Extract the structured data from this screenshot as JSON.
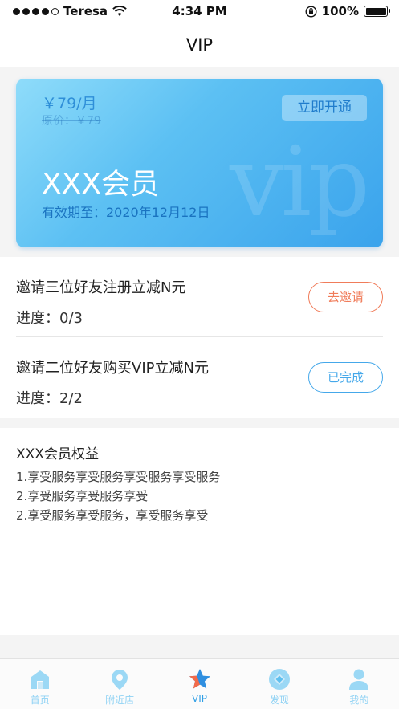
{
  "status_bar": {
    "carrier": "Teresa",
    "time": "4:34 PM",
    "battery": "100%"
  },
  "nav": {
    "title": "VIP"
  },
  "vip_card": {
    "price": "￥79/月",
    "original_price": "原价：￥79",
    "open_button": "立即开通",
    "member_title": "XXX会员",
    "expiry": "有效期至：2020年12月12日",
    "watermark": "vip"
  },
  "tasks": [
    {
      "title": "邀请三位好友注册立减N元",
      "progress": "进度：0/3",
      "button": "去邀请"
    },
    {
      "title": "邀请二位好友购买VIP立减N元",
      "progress": "进度：2/2",
      "button": "已完成"
    }
  ],
  "benefits": {
    "title": "XXX会员权益",
    "items": [
      "1.享受服务享受服务享受服务享受服务",
      "2.享受服务享受服务享受",
      "2.享受服务享受服务，享受服务享受"
    ]
  },
  "tabbar": {
    "items": [
      {
        "label": "首页",
        "icon": "home-icon"
      },
      {
        "label": "附近店",
        "icon": "location-pin-icon"
      },
      {
        "label": "VIP",
        "icon": "star-icon"
      },
      {
        "label": "发现",
        "icon": "discover-diamond-icon"
      },
      {
        "label": "我的",
        "icon": "profile-icon"
      }
    ],
    "active_index": 2
  },
  "colors": {
    "card_gradient_start": "#8fdcfa",
    "card_gradient_end": "#3aa3ec",
    "invite_accent": "#f07c5a",
    "done_accent": "#45a8ea",
    "tab_inactive": "#8fd2f4",
    "tab_active_star": "#2f8fe0",
    "tab_active_star_accent": "#f26b4b"
  }
}
